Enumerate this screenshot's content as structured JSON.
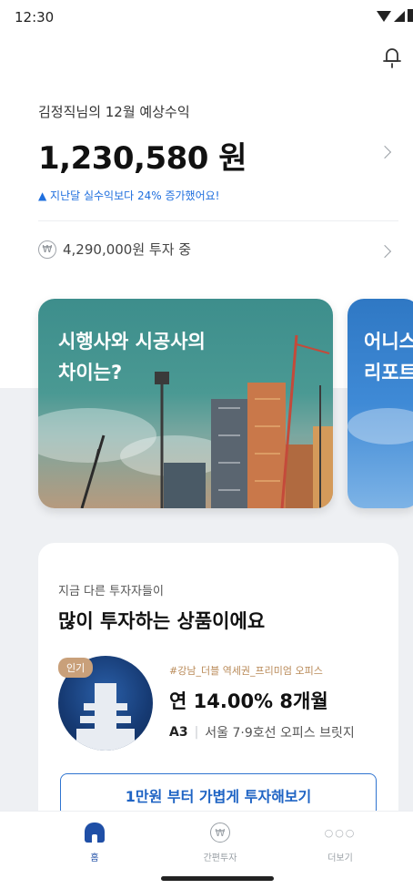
{
  "status_bar": {
    "time": "12:30"
  },
  "summary": {
    "title": "김정직님의 12월 예상수익",
    "amount": "1,230,580 원",
    "growth_text": "▲ 지난달 실수익보다 24% 증가했어요!",
    "investing_text": "4,290,000원 투자 중",
    "won_symbol": "₩"
  },
  "cards": [
    {
      "title": "시행사와 시공사의\n차이는?"
    },
    {
      "title": "어니스\n리포트"
    }
  ],
  "popular": {
    "subtitle": "지금 다른 투자자들이",
    "title": "많이 투자하는 상품이에요",
    "badge": "인기",
    "tag": "#강남_더블 역세권_프리미엄 오피스",
    "rate": "연 14.00%  8개월",
    "grade": "A3",
    "separator": "|",
    "location": "서울 7·9호선 오피스 브릿지",
    "cta": "1만원 부터 가볍게 투자해보기"
  },
  "nav": {
    "home": "홈",
    "invest": "간편투자",
    "more": "더보기",
    "more_icon": "○○○",
    "won_symbol": "₩"
  },
  "colors": {
    "accent": "#1f4fa6",
    "link_blue": "#1f6fde",
    "badge": "#c9a07a",
    "tag": "#b98a58"
  }
}
